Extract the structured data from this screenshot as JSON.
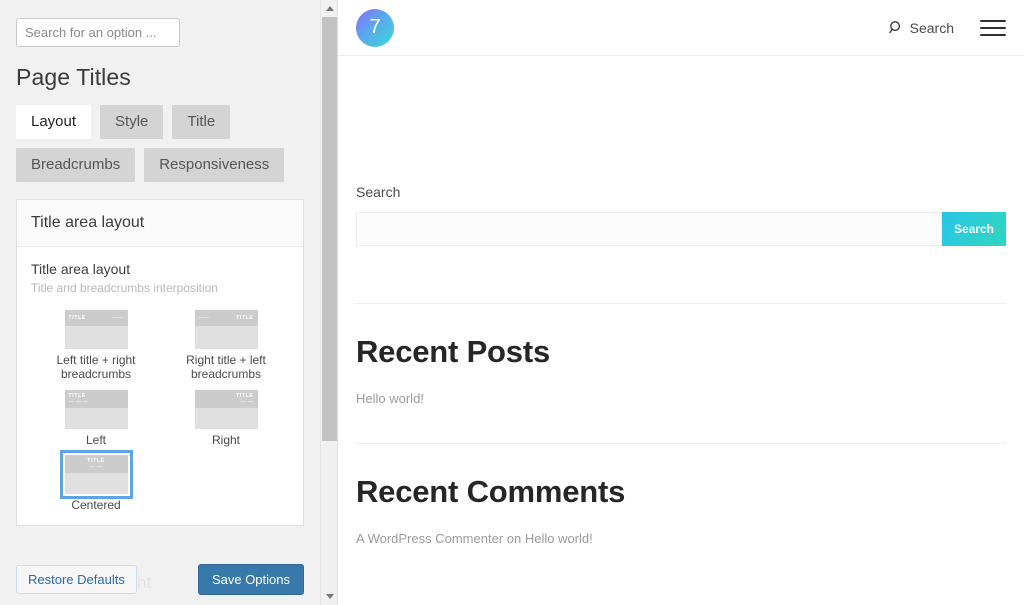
{
  "options_panel": {
    "search": {
      "placeholder": "Search for an option ...",
      "value": ""
    },
    "heading": "Page Titles",
    "tabs": [
      {
        "label": "Layout",
        "active": true
      },
      {
        "label": "Style",
        "active": false
      },
      {
        "label": "Title",
        "active": false
      },
      {
        "label": "Breadcrumbs",
        "active": false
      },
      {
        "label": "Responsiveness",
        "active": false
      }
    ],
    "card": {
      "header": "Title area layout",
      "option_label": "Title area layout",
      "option_description": "Title and breadcrumbs interposition",
      "choices": [
        {
          "caption": "Left title + right breadcrumbs",
          "title_text": "TITLE",
          "crumb_text": "——",
          "layout": "split-left",
          "selected": false
        },
        {
          "caption": "Right title + left breadcrumbs",
          "title_text": "TITLE",
          "crumb_text": "——",
          "layout": "split-right",
          "selected": false
        },
        {
          "caption": "Left",
          "title_text": "TITLE",
          "crumb_text": "— — —",
          "layout": "stack-left",
          "selected": false
        },
        {
          "caption": "Right",
          "title_text": "TITLE",
          "crumb_text": "— —",
          "layout": "stack-right",
          "selected": false
        },
        {
          "caption": "Centered",
          "title_text": "TITLE",
          "crumb_text": "— —",
          "layout": "stack-center",
          "selected": true
        }
      ]
    },
    "ghost_text": "Title area height",
    "actions": {
      "restore_label": "Restore Defaults",
      "save_label": "Save Options"
    }
  },
  "site_preview": {
    "header": {
      "logo_text": "7",
      "search_label": "Search",
      "menu_icon": "hamburger-icon"
    },
    "widgets": {
      "search": {
        "title": "Search",
        "input_value": "",
        "input_placeholder": "",
        "button_label": "Search"
      },
      "recent_posts": {
        "title": "Recent Posts",
        "items": [
          "Hello world!"
        ]
      },
      "recent_comments": {
        "title": "Recent Comments",
        "items": [
          "A WordPress Commenter on Hello world!"
        ]
      }
    }
  },
  "colors": {
    "accent_primary": "#3878ab",
    "accent_link": "#2b6ca3",
    "selection_border": "#5ba4e5",
    "site_gradient_start": "#29c5e8",
    "site_gradient_end": "#2fd6bd",
    "panel_background": "#f1f1f1"
  }
}
